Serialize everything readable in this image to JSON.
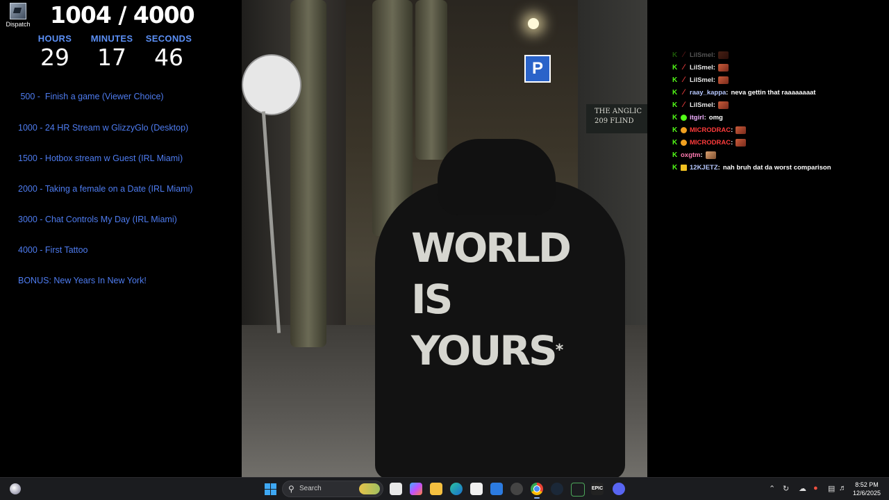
{
  "desktop": {
    "icon_label": "Dispatch"
  },
  "goal_counter": "1004 / 4000",
  "timer": {
    "hours_label": "HOURS",
    "hours": "29",
    "minutes_label": "MINUTES",
    "minutes": "17",
    "seconds_label": "SECONDS",
    "seconds": "46"
  },
  "goals": [
    " 500 -  Finish a game (Viewer Choice)",
    "1000 - 24 HR Stream w GlizzyGlo (Desktop)",
    "1500 - Hotbox stream w Guest (IRL Miami)",
    "2000 - Taking a female on a Date (IRL Miami)",
    "3000 - Chat Controls My Day (IRL Miami)",
    "4000 - First Tattoo",
    "BONUS: New Years In New York!"
  ],
  "video": {
    "p_sign": "P",
    "street_sign": [
      "THE ANGLIC",
      "209 FLIND"
    ],
    "hoodie_print": "WORLD\nIS\nYOURS",
    "hoodie_star": "*"
  },
  "chat": [
    {
      "user": "LilSmel",
      "color": "#e8e8e8",
      "badge": "slash",
      "badge_color": "#e23b3b",
      "message": "",
      "emote": true,
      "emote_type": "",
      "fade": true
    },
    {
      "user": "LilSmel",
      "color": "#e8e8e8",
      "badge": "slash",
      "badge_color": "#e23b3b",
      "message": "",
      "emote": true,
      "emote_type": "",
      "fade": false
    },
    {
      "user": "LilSmel",
      "color": "#e8e8e8",
      "badge": "slash",
      "badge_color": "#e23b3b",
      "message": "",
      "emote": true,
      "emote_type": "",
      "fade": false
    },
    {
      "user": "raay_kappa",
      "color": "#b6c8ff",
      "badge": "slash",
      "badge_color": "#e23b3b",
      "message": "neva gettin that raaaaaaaat",
      "emote": false,
      "emote_type": "",
      "fade": false
    },
    {
      "user": "LilSmel",
      "color": "#e8e8e8",
      "badge": "slash",
      "badge_color": "#e23b3b",
      "message": "",
      "emote": true,
      "emote_type": "",
      "fade": false
    },
    {
      "user": "itgirl",
      "color": "#f0b0ff",
      "badge": "check",
      "badge_color": "#53fc18",
      "message": "omg",
      "emote": false,
      "emote_type": "",
      "fade": false
    },
    {
      "user": "MICRODRAC",
      "color": "#ff3b3b",
      "badge": "coin",
      "badge_color": "#f0a020",
      "message": "",
      "emote": true,
      "emote_type": "",
      "fade": false
    },
    {
      "user": "MICRODRAC",
      "color": "#ff3b3b",
      "badge": "coin",
      "badge_color": "#f0a020",
      "message": "",
      "emote": true,
      "emote_type": "",
      "fade": false
    },
    {
      "user": "oxgtm",
      "color": "#ff7ab0",
      "badge": "",
      "badge_color": "",
      "message": "",
      "emote": true,
      "emote_type": "face",
      "fade": false
    },
    {
      "user": "12KJETZ",
      "color": "#b6c8ff",
      "badge": "crown",
      "badge_color": "#f0c020",
      "message": "nah bruh dat da worst comparison",
      "emote": false,
      "emote_type": "",
      "fade": false
    }
  ],
  "chat_kick_glyph": "K",
  "taskbar": {
    "search_placeholder": "Search",
    "apps": [
      "file-explorer-icon",
      "copilot-icon",
      "folder-icon",
      "edge-icon",
      "store-icon",
      "mail-icon",
      "camera-icon",
      "chrome-icon",
      "steam-icon",
      "xbox-icon",
      "epic-games-icon",
      "discord-icon"
    ],
    "epic_label": "EPIC",
    "time": "8:52 PM",
    "date": "12/6/2025"
  }
}
